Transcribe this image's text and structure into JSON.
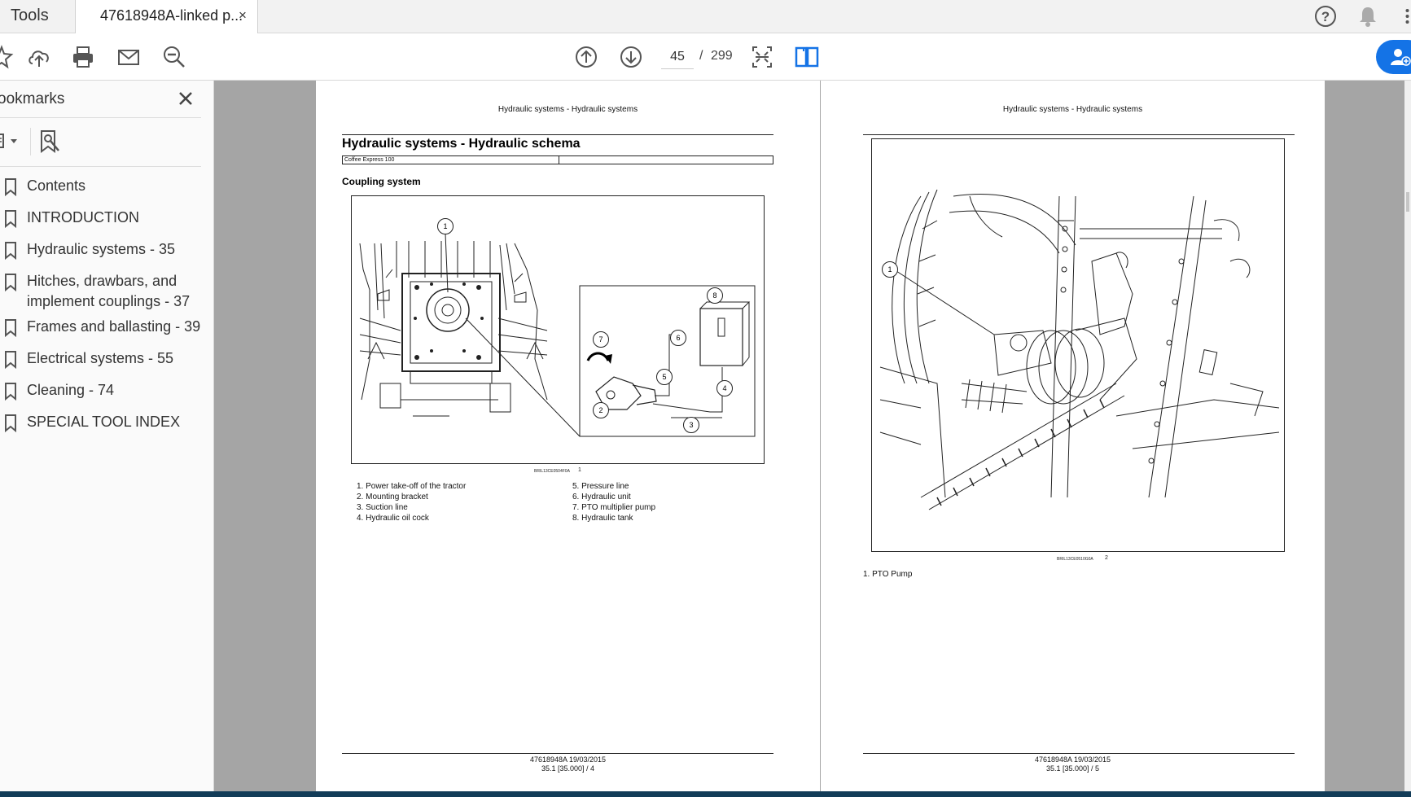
{
  "tabs": {
    "tools_label": "Tools",
    "document_title": "47618948A-linked p...",
    "close_symbol": "×"
  },
  "toolbar": {
    "current_page": "45",
    "page_separator": "/",
    "total_pages": "299"
  },
  "sidebar": {
    "title": "ookmarks",
    "items": [
      {
        "label": "Contents"
      },
      {
        "label": "INTRODUCTION"
      },
      {
        "label": "Hydraulic systems - 35"
      },
      {
        "label": "Hitches, drawbars, and implement couplings - 37"
      },
      {
        "label": "Frames and ballasting - 39"
      },
      {
        "label": "Electrical systems - 55"
      },
      {
        "label": "Cleaning - 74"
      },
      {
        "label": "SPECIAL TOOL INDEX"
      }
    ]
  },
  "left_page": {
    "header": "Hydraulic systems - Hydraulic schema",
    "header_top": "Hydraulic systems - Hydraulic systems",
    "title": "Hydraulic systems - Hydraulic schema",
    "model": "Coffee Express 100",
    "section": "Coupling system",
    "figure_ref": "BRIL13CE0504F0A",
    "figure_number": "1",
    "callouts": [
      "1",
      "2",
      "3",
      "4",
      "5",
      "6",
      "7",
      "8"
    ],
    "legend_left": [
      "1.  Power take-off of the tractor",
      "2.  Mounting bracket",
      "3.  Suction line",
      "4.  Hydraulic oil cock"
    ],
    "legend_right": [
      "5.  Pressure line",
      "6.  Hydraulic unit",
      "7.  PTO multiplier pump",
      "8.  Hydraulic tank"
    ],
    "footer_line1": "47618948A 19/03/2015",
    "footer_line2": "35.1 [35.000] / 4"
  },
  "right_page": {
    "header": "Hydraulic systems - Hydraulic systems",
    "figure_ref": "BRIL13CE0510G0A",
    "figure_number": "2",
    "callout": "1",
    "legend": [
      "1.  PTO Pump"
    ],
    "footer_line1": "47618948A 19/03/2015",
    "footer_line2": "35.1 [35.000] / 5"
  },
  "colors": {
    "accent": "#1473e6",
    "canvas": "#a5a5a5",
    "bottom_bar": "#123c58"
  }
}
